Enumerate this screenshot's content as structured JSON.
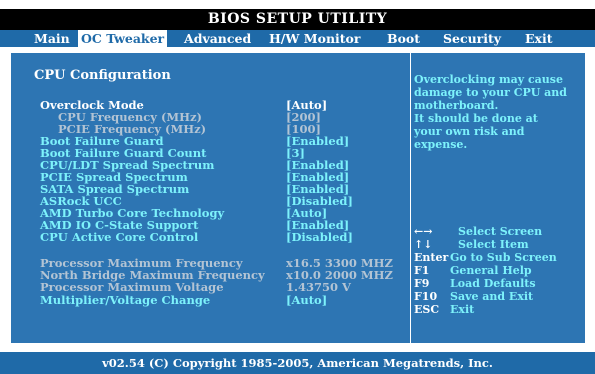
{
  "title": "BIOS SETUP UTILITY",
  "menu": [
    "Main",
    "OC Tweaker",
    "Advanced",
    "H/W Monitor",
    "Boot",
    "Security",
    "Exit"
  ],
  "menu_active": "OC Tweaker",
  "section_title": "CPU Configuration",
  "settings": [
    {
      "label": "Overclock Mode",
      "value": "[Auto]"
    },
    {
      "label": "CPU Frequency (MHz)",
      "value": "[200]"
    },
    {
      "label": "PCIE Frequency (MHz)",
      "value": "[100]"
    },
    {
      "label": "Boot Failure Guard",
      "value": "[Enabled]"
    },
    {
      "label": "Boot Failure Guard Count",
      "value": "[3]"
    },
    {
      "label": "CPU/LDT Spread Spectrum",
      "value": "[Enabled]"
    },
    {
      "label": "PCIE Spread Spectrum",
      "value": "[Enabled]"
    },
    {
      "label": "SATA Spread Spectrum",
      "value": "[Enabled]"
    },
    {
      "label": "ASRock UCC",
      "value": "[Disabled]"
    },
    {
      "label": "AMD Turbo Core Technology",
      "value": "[Auto]"
    },
    {
      "label": "AMD IO C-State Support",
      "value": "[Enabled]"
    },
    {
      "label": "CPU Active Core Control",
      "value": "[Disabled]"
    }
  ],
  "info": [
    {
      "label": "Processor Maximum Frequency",
      "value": "x16.5 3300 MHZ"
    },
    {
      "label": "North Bridge Maximum Frequency",
      "value": "x10.0 2000 MHZ"
    },
    {
      "label": "Processor Maximum Voltage",
      "value": "1.43750 V"
    }
  ],
  "multiplier": {
    "label": "Multiplier/Voltage Change",
    "value": "[Auto]"
  },
  "help_text": [
    "Overclocking may cause",
    "damage to your CPU and",
    "motherboard.",
    "It should be done at",
    "your own risk and",
    "expense."
  ],
  "keys": [
    {
      "key": "←→",
      "desc": "Select Screen"
    },
    {
      "key": "↑↓",
      "desc": "Select Item"
    },
    {
      "key": "Enter",
      "desc": "Go to Sub Screen"
    },
    {
      "key": "F1",
      "desc": "General Help"
    },
    {
      "key": "F9",
      "desc": "Load Defaults"
    },
    {
      "key": "F10",
      "desc": "Save and Exit"
    },
    {
      "key": "ESC",
      "desc": "Exit"
    }
  ],
  "footer": "v02.54 (C) Copyright 1985-2005, American Megatrends, Inc.",
  "colors": {
    "bg": "#2d75b3",
    "menubar": "#1f6aa8",
    "highlight": "#7df2fb",
    "title_bg": "#000000"
  }
}
